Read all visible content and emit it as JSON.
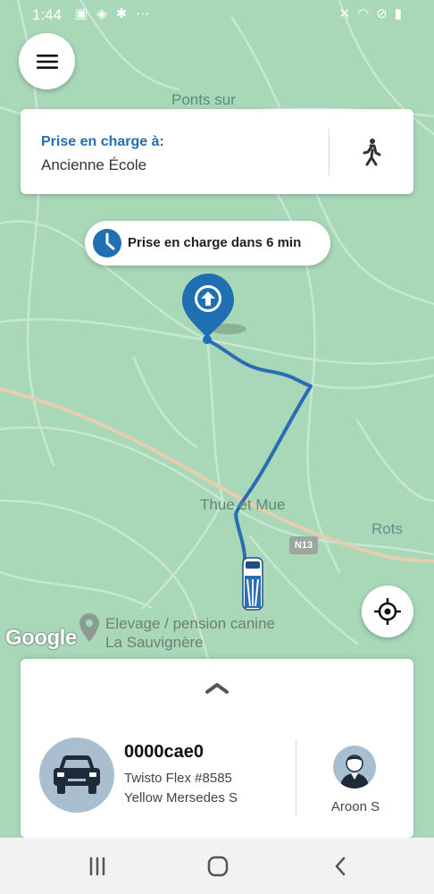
{
  "status_bar": {
    "time": "1:44",
    "left_icons": [
      "gallery-icon",
      "location-icon",
      "slack-icon",
      "more-icon"
    ],
    "right_icons": [
      "mute-icon",
      "wifi-icon",
      "dnd-icon",
      "battery-icon"
    ]
  },
  "header": {
    "menu_icon": "hamburger-menu-icon"
  },
  "pickup_card": {
    "label": "Prise en charge à:",
    "location": "Ancienne École",
    "walk_icon": "walking-person-icon"
  },
  "eta": {
    "text": "Prise en charge dans 6 min",
    "icon": "clock-icon"
  },
  "map": {
    "labels": {
      "ponts": "Ponts sur",
      "thue": "Thue et Mue",
      "rots": "Rots",
      "road": "N13"
    },
    "place": "Elevage / pension canine La Sauvignère",
    "attribution": "Google",
    "locate_icon": "my-location-icon"
  },
  "bottom_sheet": {
    "expand_icon": "chevron-up-icon",
    "vehicle": {
      "plate": "0000cae0",
      "model": "Twisto Flex #8585",
      "color": "Yellow Mersedes S"
    },
    "driver": {
      "name": "Aroon S"
    }
  },
  "nav_bar": {
    "icons": [
      "recents-icon",
      "home-icon",
      "back-icon"
    ]
  },
  "colors": {
    "accent": "#1f6fb2",
    "map_green": "#a8d8b8",
    "route": "#2a6db4"
  }
}
